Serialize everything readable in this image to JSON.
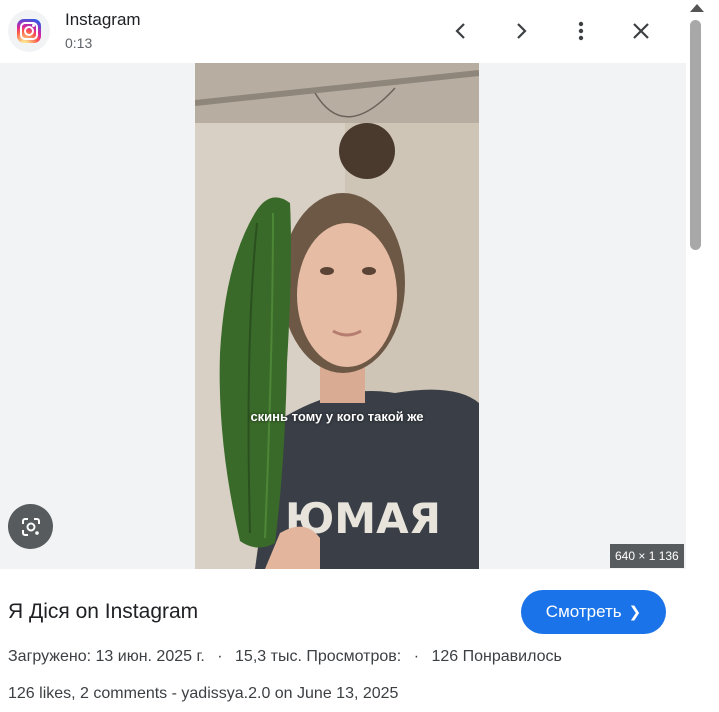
{
  "header": {
    "app_name": "Instagram",
    "duration": "0:13",
    "icons": {
      "app": "instagram-icon",
      "prev": "chevron-left-icon",
      "next": "chevron-right-icon",
      "more": "more-vert-icon",
      "close": "close-icon"
    }
  },
  "media": {
    "overlay_caption": "скинь тому у кого такой же",
    "shirt_text": "ЮМАЯ",
    "dimensions": "640 × 1 136",
    "lens_icon": "google-lens-icon"
  },
  "info": {
    "title": "Я Дiся on Instagram",
    "open_button": "Смотреть",
    "uploaded": "Загружено: 13 июн. 2025 г.",
    "views": "15,3 тыс. Просмотров:",
    "likes": "126 Понравилось",
    "separator": "·",
    "description": "126 likes, 2 comments - yadissya.2.0 on June 13, 2025"
  },
  "colors": {
    "accent": "#1a73e8",
    "panel_bg": "#f1f3f4",
    "badge_bg": "#3c4043"
  }
}
